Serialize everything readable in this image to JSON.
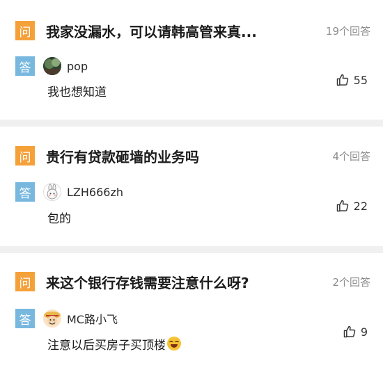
{
  "questions": [
    {
      "badge_q": "问",
      "title": "我家没漏水，可以请韩高管来真...",
      "answer_count": "19个回答",
      "badge_a": "答",
      "avatar_icon": "nature-photo-avatar",
      "username": "pop",
      "answer": "我也想知道",
      "likes": "55"
    },
    {
      "badge_q": "问",
      "title": "贵行有贷款砸墙的业务吗",
      "answer_count": "4个回答",
      "badge_a": "答",
      "avatar_icon": "bunny-avatar",
      "username": "LZH666zh",
      "answer": "包的",
      "likes": "22"
    },
    {
      "badge_q": "问",
      "title": "来这个银行存钱需要注意什么呀?",
      "answer_count": "2个回答",
      "badge_a": "答",
      "avatar_icon": "cartoon-pirate-avatar",
      "username": "MC路小飞",
      "answer": "注意以后买房子买顶楼",
      "answer_emoji": "laughing-tears-emoji",
      "likes": "9"
    }
  ],
  "colors": {
    "question_badge": "#f5a13a",
    "answer_badge": "#78b8df",
    "background": "#f0f0f0",
    "card": "#ffffff"
  }
}
